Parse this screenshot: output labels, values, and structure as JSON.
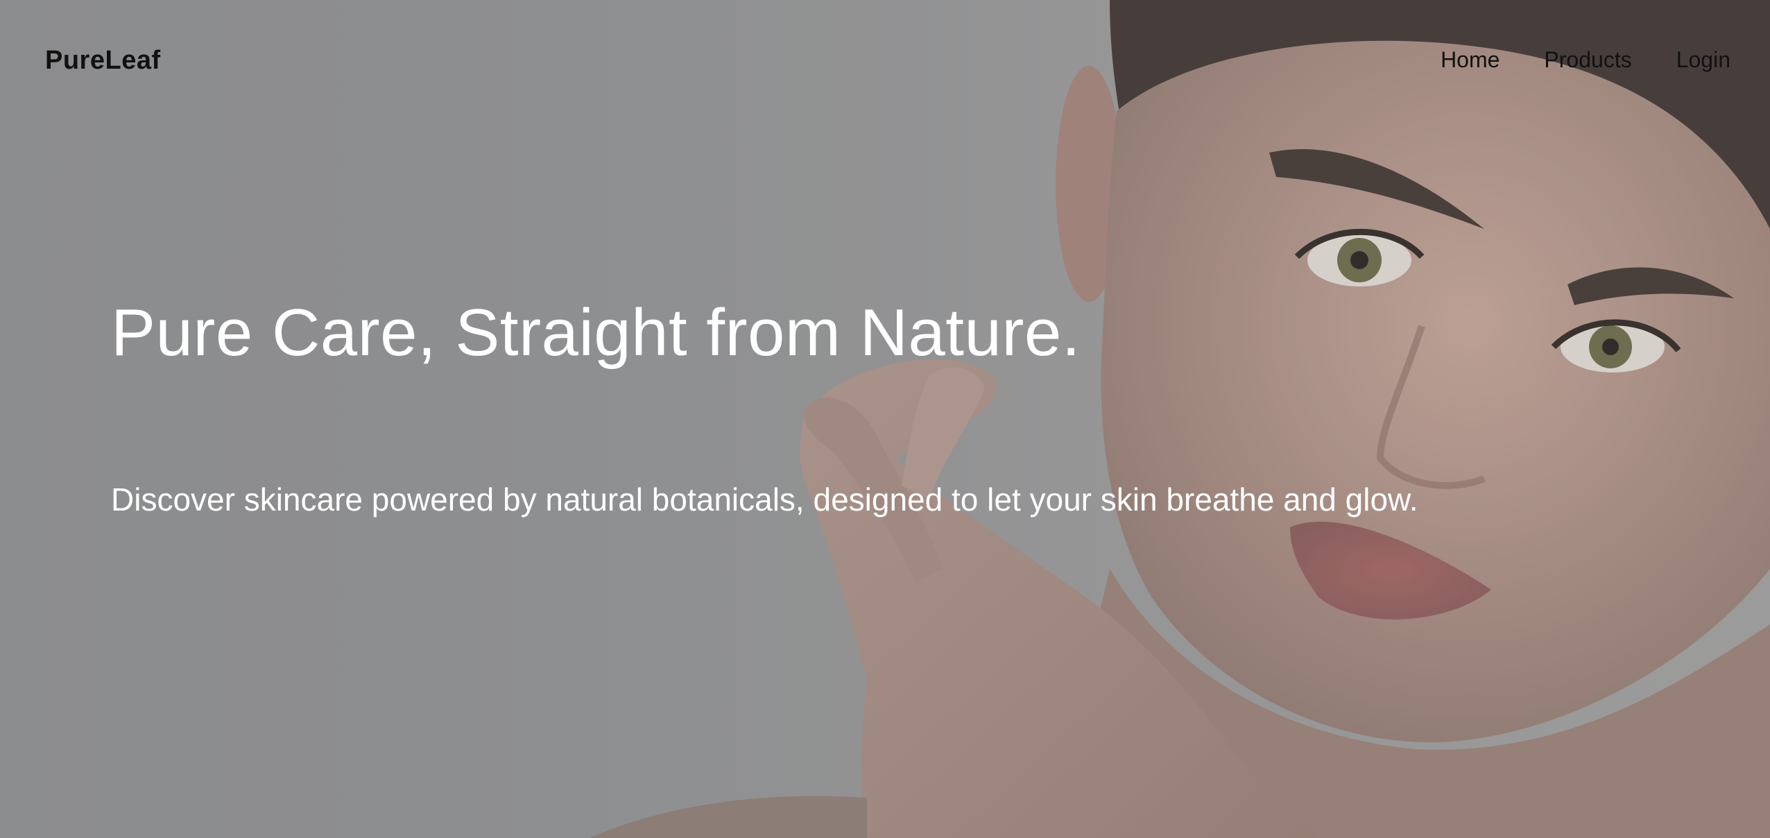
{
  "brand": {
    "name": "PureLeaf"
  },
  "nav": {
    "items": [
      {
        "label": "Home"
      },
      {
        "label": "Products"
      },
      {
        "label": "Login"
      }
    ]
  },
  "hero": {
    "headline": "Pure Care, Straight from Nature.",
    "subtext": "Discover skincare powered by natural botanicals, designed to let your skin breathe and glow.",
    "image": "woman-portrait-with-hands-photo"
  },
  "colors": {
    "overlay": "#8f9092",
    "text_light": "#ffffff",
    "text_dark": "#111111"
  }
}
